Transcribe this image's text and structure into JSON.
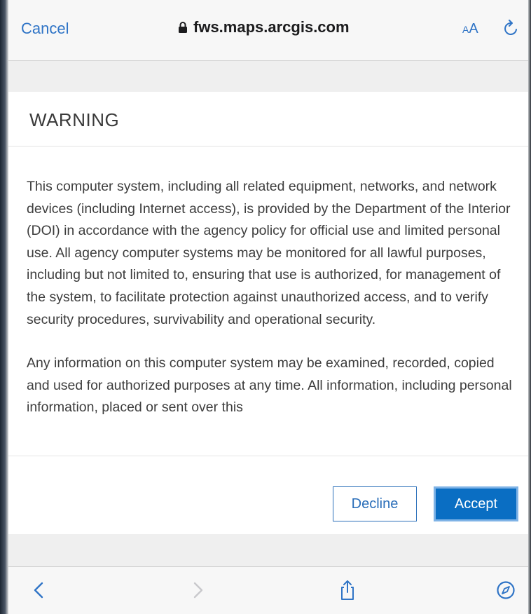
{
  "browser": {
    "cancel_label": "Cancel",
    "url": "fws.maps.arcgis.com",
    "text_size_small": "A",
    "text_size_large": "A",
    "accent_color": "#2f74c6"
  },
  "dialog": {
    "title": "WARNING",
    "paragraphs": [
      "This computer system, including all related equipment, networks, and network devices (including Internet access), is provided by the Department of the Interior (DOI) in accordance with the agency policy for official use and limited personal use. All agency computer systems may be monitored for all lawful purposes, including but not limited to, ensuring that use is authorized, for management of the system, to facilitate protection against unauthorized access, and to verify security procedures, survivability and operational security.",
      "Any information on this computer system may be examined, recorded, copied and used for authorized purposes at any time. All information, including personal information, placed or sent over this"
    ],
    "decline_label": "Decline",
    "accept_label": "Accept",
    "accept_color": "#0a6ec3"
  },
  "toolbar": {
    "icons": [
      "back-icon",
      "forward-icon",
      "share-icon",
      "compass-icon"
    ]
  }
}
